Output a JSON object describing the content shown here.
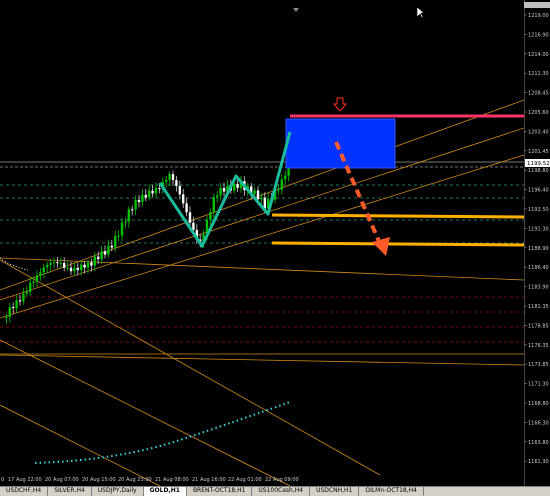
{
  "chart": {
    "symbol": "GOLD",
    "timeframe": "H1",
    "current_price": "1199.52",
    "price_ticks": [
      "1219.00",
      "1216.90",
      "1214.00",
      "1211.30",
      "1208.45",
      "1205.60",
      "1203.40",
      "1201.45",
      "1198.80",
      "1196.40",
      "1193.50",
      "1191.30",
      "1188.90",
      "1186.40",
      "1183.90",
      "1181.35",
      "1178.85",
      "1176.35",
      "1173.85",
      "1171.30",
      "1168.80",
      "1166.30",
      "1163.80",
      "1161.30"
    ],
    "time_ticks": [
      "17 Aug 22:00",
      "20 Aug 07:00",
      "20 Aug 15:00",
      "20 Aug 23:00",
      "21 Aug 08:00",
      "21 Aug 16:00",
      "22 Aug 01:00",
      "22 Aug 09:00"
    ],
    "time_tick_first": "0",
    "colors": {
      "background": "#000000",
      "bull_candle": "#00c000",
      "bear_candle": "#ffffff",
      "trendline": "#d08a1c",
      "resistance": "#ff3366",
      "support": "#ffb000",
      "zone": "#0033ff",
      "pattern": "#1abc9c",
      "arrow": "#ff5a2a"
    }
  },
  "tabs": [
    {
      "label": "USDCHF,H4",
      "active": false
    },
    {
      "label": "SILVER,H4",
      "active": false
    },
    {
      "label": "USDJPY,Daily",
      "active": false
    },
    {
      "label": "GOLD,H1",
      "active": true
    },
    {
      "label": "BRENT-OCT18,H1",
      "active": false
    },
    {
      "label": "US100Cash,H4",
      "active": false
    },
    {
      "label": "USDCNH,H1",
      "active": false
    },
    {
      "label": "OILMn-OCT18,H4",
      "active": false
    }
  ]
}
